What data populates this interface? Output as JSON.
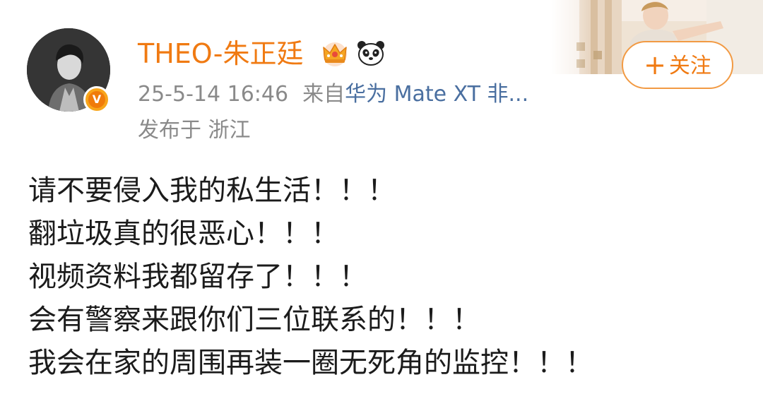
{
  "author": {
    "name": "THEO-朱正廷",
    "verified_mark": "V",
    "badges": [
      "crown-icon",
      "panda-icon"
    ]
  },
  "meta": {
    "timestamp": "25-5-14 16:46",
    "source_prefix": "来自",
    "source": "华为 Mate XT 非...",
    "location": "发布于 浙江"
  },
  "follow": {
    "plus": "+",
    "label": "关注"
  },
  "post": {
    "lines": [
      "请不要侵入我的私生活！！！",
      "翻垃圾真的很恶心！！！",
      "视频资料我都留存了！！！",
      "会有警察来跟你们三位联系的！！！",
      "我会在家的周围再装一圈无死角的监控！！！"
    ]
  },
  "colors": {
    "username": "#f07a12",
    "follow_border": "#f29a43",
    "meta_gray": "#8a8a8a",
    "source_blue": "#4a6fa0",
    "body_text": "#1b1b1b"
  }
}
